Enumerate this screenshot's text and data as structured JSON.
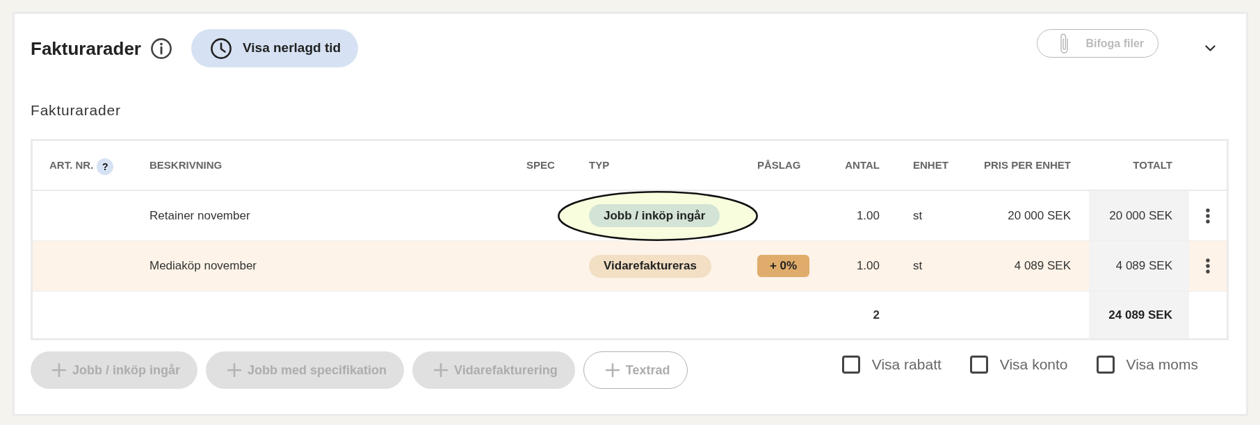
{
  "header": {
    "title": "Fakturarader",
    "time_button": {
      "label": "Visa nerlagd tid"
    },
    "attach_button": {
      "label": "Bifoga filer",
      "disabled": true
    }
  },
  "section_label": "Fakturarader",
  "table": {
    "columns": [
      {
        "label": "ART. NR.",
        "help": "?"
      },
      {
        "label": "BESKRIVNING"
      },
      {
        "label": "SPEC"
      },
      {
        "label": "TYP"
      },
      {
        "label": "PÅSLAG"
      },
      {
        "label": "ANTAL"
      },
      {
        "label": "ENHET"
      },
      {
        "label": "PRIS PER ENHET"
      },
      {
        "label": "TOTALT"
      }
    ],
    "rows": [
      {
        "kind": "included",
        "highlighted": true,
        "description": "Retainer november",
        "type": "Jobb / inköp ingår",
        "quantity": "1.00",
        "unit": "st",
        "unit_price": "20 000 SEK",
        "total": "20 000 SEK"
      },
      {
        "kind": "rebilled",
        "highlighted": false,
        "description": "Mediaköp november",
        "type": "Vidarefaktureras",
        "markup": "+ 0%",
        "quantity": "1.00",
        "unit": "st",
        "unit_price": "4 089 SEK",
        "total": "4 089 SEK"
      }
    ],
    "footer": {
      "quantity": "2",
      "total": "24 089 SEK"
    }
  },
  "actions": [
    {
      "kind": "filled",
      "label": "Jobb / inköp ingår",
      "disabled": true
    },
    {
      "kind": "filled",
      "label": "Jobb med specifikation",
      "disabled": true
    },
    {
      "kind": "filled",
      "label": "Vidarefakturering",
      "disabled": true
    },
    {
      "kind": "outlined",
      "label": "Textrad",
      "disabled": true
    }
  ],
  "options": [
    {
      "label": "Visa rabatt",
      "checked": false
    },
    {
      "label": "Visa konto",
      "checked": false
    },
    {
      "label": "Visa moms",
      "checked": false
    }
  ]
}
